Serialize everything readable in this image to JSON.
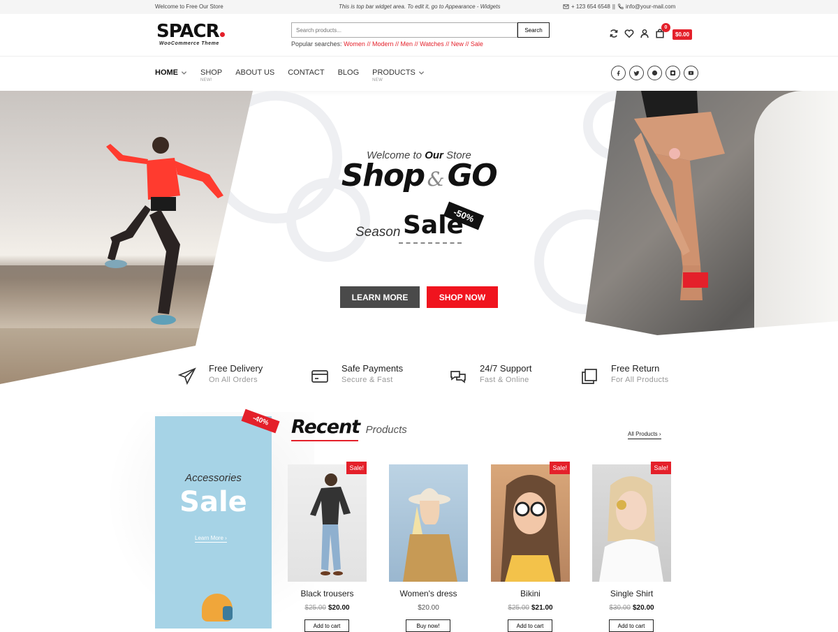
{
  "topbar": {
    "welcome": "Welcome to Free Our Store",
    "widget_note": "This is top bar widget area. To edit it, go to Appearance - Widgets",
    "phone": "+ 123 654 6548",
    "separator": "||",
    "email": "info@your-mail.com"
  },
  "logo": {
    "name": "SPACR",
    "subtitle": "WooCommerce Theme"
  },
  "search": {
    "placeholder": "Search products...",
    "button": "Search",
    "popular_label": "Popular searches:",
    "popular_terms": [
      "Women",
      "Modern",
      "Men",
      "Watches",
      "New",
      "Sale"
    ],
    "term_separator": "//"
  },
  "cart": {
    "count": "0",
    "total": "$0.00"
  },
  "nav": {
    "items": [
      {
        "label": "HOME",
        "tag": ""
      },
      {
        "label": "SHOP",
        "tag": "NEW!"
      },
      {
        "label": "ABOUT US",
        "tag": ""
      },
      {
        "label": "CONTACT",
        "tag": ""
      },
      {
        "label": "BLOG",
        "tag": ""
      },
      {
        "label": "PRODUCTS",
        "tag": "NEW"
      }
    ],
    "socials": [
      "facebook-icon",
      "twitter-icon",
      "pinterest-icon",
      "instagram-icon",
      "youtube-icon"
    ]
  },
  "hero": {
    "welcome_pre": "Welcome to",
    "welcome_bold": "Our",
    "welcome_post": "Store",
    "headline_a": "Shop",
    "headline_amp": "&",
    "headline_b": "GO",
    "season": "Season",
    "sale": "Sale",
    "discount": "-50%",
    "learn_more": "LEARN MORE",
    "shop_now": "SHOP NOW"
  },
  "features": [
    {
      "icon": "paper-plane-icon",
      "title": "Free Delivery",
      "sub": "On All Orders"
    },
    {
      "icon": "credit-card-icon",
      "title": "Safe Payments",
      "sub": "Secure & Fast"
    },
    {
      "icon": "chat-icon",
      "title": "24/7 Support",
      "sub": "Fast & Online"
    },
    {
      "icon": "copy-icon",
      "title": "Free Return",
      "sub": "For All Products"
    }
  ],
  "promo": {
    "kicker": "Accessories",
    "title": "Sale",
    "link": "Learn More",
    "badge": "-40%"
  },
  "recent": {
    "title": "Recent",
    "subtitle": "Products",
    "all_link": "All Products"
  },
  "products": [
    {
      "name": "Black trousers",
      "old_price": "$25.00",
      "price": "$20.00",
      "sale": "Sale!",
      "button": "Add to cart"
    },
    {
      "name": "Women's dress",
      "old_price": "",
      "price": "$20.00",
      "sale": "",
      "button": "Buy now!"
    },
    {
      "name": "Bikini",
      "old_price": "$25.00",
      "price": "$21.00",
      "sale": "Sale!",
      "button": "Add to cart"
    },
    {
      "name": "Single Shirt",
      "old_price": "$30.00",
      "price": "$20.00",
      "sale": "Sale!",
      "button": "Add to cart"
    }
  ],
  "colors": {
    "accent": "#e4202a",
    "dark_button": "#4a4a4a",
    "promo_bg": "#a6d3e6"
  }
}
